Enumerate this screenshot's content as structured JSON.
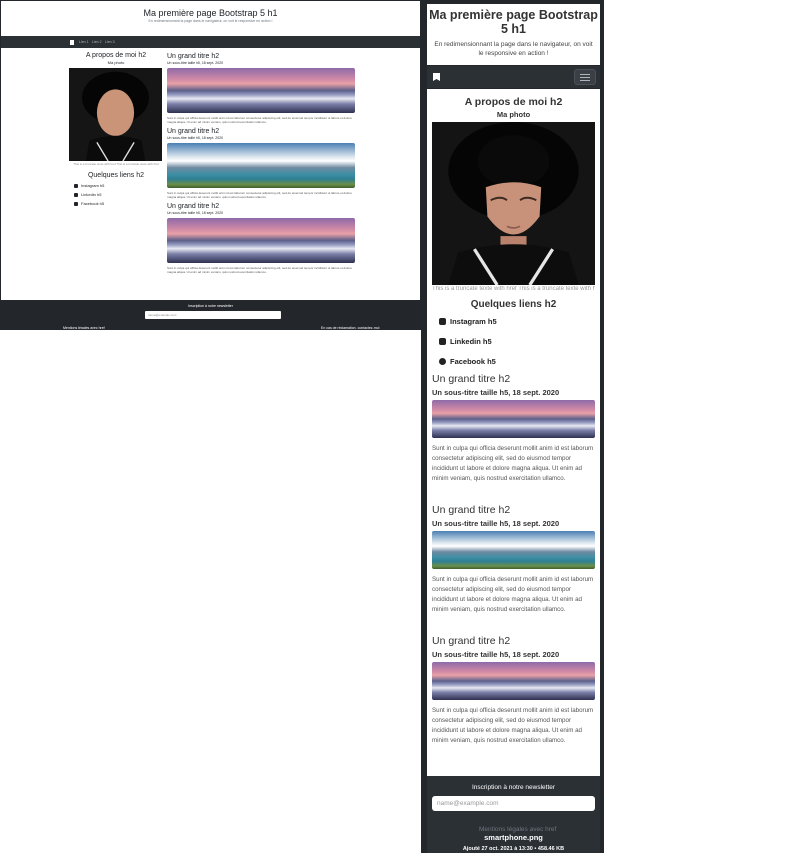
{
  "desktop": {
    "title": "Ma première page Bootstrap 5 h1",
    "subtitle": "En redimensionnant la page dans le navigateur, on voit le responsive en action !",
    "nav": {
      "links": [
        "Lien 1",
        "Lien 2",
        "Lien 3"
      ]
    },
    "aside": {
      "heading": "A propos de moi h2",
      "photo_label": "Ma photo",
      "truncate": "This is a truncate texte with href This is a truncate texte with href",
      "links_heading": "Quelques liens h2",
      "links": [
        "Instagram h5",
        "Linkedin h5",
        "Facebook h5"
      ]
    },
    "articles": [
      {
        "title": "Un grand titre h2",
        "subtitle": "Un sous-titre taille h5, 18 sept. 2020",
        "text": "Sunt in culpa qui officia deserunt mollit anim id est laborum consectetur adipiscing elit, sed do eiusmod tempor incididunt ut labore et dolore magna aliqua. Ut enim ad minim veniam, quis nostrud exercitation ullamco."
      },
      {
        "title": "Un grand titre h2",
        "subtitle": "Un sous-titre taille h5, 18 sept. 2020",
        "text": "Sunt in culpa qui officia deserunt mollit anim id est laborum consectetur adipiscing elit, sed do eiusmod tempor incididunt ut labore et dolore magna aliqua. Ut enim ad minim veniam, quis nostrud exercitation ullamco."
      },
      {
        "title": "Un grand titre h2",
        "subtitle": "Un sous-titre taille h5, 18 sept. 2020",
        "text": "Sunt in culpa qui officia deserunt mollit anim id est laborum consectetur adipiscing elit, sed do eiusmod tempor incididunt ut labore et dolore magna aliqua. Ut enim ad minim veniam, quis nostrud exercitation ullamco."
      }
    ],
    "footer": {
      "newsletter": "Inscription à notre newsletter",
      "email_placeholder": "name@example.com",
      "left": "Mentions légales avec href",
      "right": "En cas de réclamation, contactez-moi"
    }
  },
  "phone": {
    "title": "Ma première page Bootstrap 5 h1",
    "subtitle": "En redimensionnant la page dans le navigateur, on voit le responsive en action !",
    "aside": {
      "heading": "A propos de moi h2",
      "photo_label": "Ma photo",
      "truncate": "This is a truncate texte with href This is a truncate texte with href",
      "links_heading": "Quelques liens h2",
      "links": [
        "Instagram h5",
        "Linkedin h5",
        "Facebook h5"
      ]
    },
    "articles": [
      {
        "title": "Un grand titre h2",
        "subtitle": "Un sous-titre taille h5, 18 sept. 2020",
        "text": "Sunt in culpa qui officia deserunt mollit anim id est laborum consectetur adipiscing elit, sed do eiusmod tempor incididunt ut labore et dolore magna aliqua. Ut enim ad minim veniam, quis nostrud exercitation ullamco."
      },
      {
        "title": "Un grand titre h2",
        "subtitle": "Un sous-titre taille h5, 18 sept. 2020",
        "text": "Sunt in culpa qui officia deserunt mollit anim id est laborum consectetur adipiscing elit, sed do eiusmod tempor incididunt ut labore et dolore magna aliqua. Ut enim ad minim veniam, quis nostrud exercitation ullamco."
      },
      {
        "title": "Un grand titre h2",
        "subtitle": "Un sous-titre taille h5, 18 sept. 2020",
        "text": "Sunt in culpa qui officia deserunt mollit anim id est laborum consectetur adipiscing elit, sed do eiusmod tempor incididunt ut labore et dolore magna aliqua. Ut enim ad minim veniam, quis nostrud exercitation ullamco."
      }
    ],
    "footer": {
      "newsletter": "Inscription à notre newsletter",
      "email_placeholder": "name@example.com",
      "ghost_text": "Mentions légales avec href"
    },
    "file_caption": {
      "name": "smartphone.png",
      "meta": "Ajouté 27 oct. 2021 à 13:30 • 458.46 KB"
    }
  }
}
